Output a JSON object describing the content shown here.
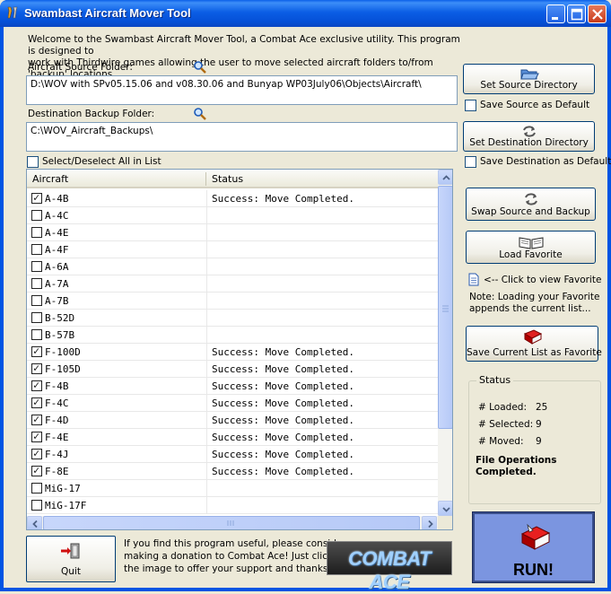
{
  "window": {
    "title": "Swambast Aircraft Mover Tool"
  },
  "welcome_line1": "Welcome to the Swambast Aircraft Mover Tool, a Combat Ace exclusive utility.  This program is designed to",
  "welcome_line2": "work with Thirdwire games allowing the user to move selected aircraft folders to/from 'backup' locations.",
  "source": {
    "label": "Aircraft Source Folder:",
    "value": "D:\\WOV with SPv05.15.06 and  v08.30.06 and Bunyap WP03July06\\Objects\\Aircraft\\"
  },
  "destination": {
    "label": "Destination Backup Folder:",
    "value": "C:\\WOV_Aircraft_Backups\\"
  },
  "select_all": {
    "label": "Select/Deselect  All in List",
    "checked": false
  },
  "list": {
    "columns": [
      "Aircraft",
      "Status"
    ],
    "rows": [
      {
        "name": "A-4B",
        "checked": true,
        "status": "Success:  Move Completed."
      },
      {
        "name": "A-4C",
        "checked": false,
        "status": ""
      },
      {
        "name": "A-4E",
        "checked": false,
        "status": ""
      },
      {
        "name": "A-4F",
        "checked": false,
        "status": ""
      },
      {
        "name": "A-6A",
        "checked": false,
        "status": ""
      },
      {
        "name": "A-7A",
        "checked": false,
        "status": ""
      },
      {
        "name": "A-7B",
        "checked": false,
        "status": ""
      },
      {
        "name": "B-52D",
        "checked": false,
        "status": ""
      },
      {
        "name": "B-57B",
        "checked": false,
        "status": ""
      },
      {
        "name": "F-100D",
        "checked": true,
        "status": "Success:  Move Completed."
      },
      {
        "name": "F-105D",
        "checked": true,
        "status": "Success:  Move Completed."
      },
      {
        "name": "F-4B",
        "checked": true,
        "status": "Success:  Move Completed."
      },
      {
        "name": "F-4C",
        "checked": true,
        "status": "Success:  Move Completed."
      },
      {
        "name": "F-4D",
        "checked": true,
        "status": "Success:  Move Completed."
      },
      {
        "name": "F-4E",
        "checked": true,
        "status": "Success:  Move Completed."
      },
      {
        "name": "F-4J",
        "checked": true,
        "status": "Success:  Move Completed."
      },
      {
        "name": "F-8E",
        "checked": true,
        "status": "Success:  Move Completed."
      },
      {
        "name": "MiG-17",
        "checked": false,
        "status": ""
      },
      {
        "name": "MiG-17F",
        "checked": false,
        "status": ""
      }
    ]
  },
  "buttons": {
    "set_source": "Set Source Directory",
    "save_source_default": "Save Source as Default",
    "set_destination": "Set Destination Directory",
    "save_destination_default": "Save Destination as Default",
    "swap": "Swap Source and Backup",
    "load_favorite": "Load Favorite",
    "view_favorite": "<-- Click to view Favorite",
    "note_line1": "Note: Loading your Favorite",
    "note_line2": "appends the current list...",
    "save_favorite": "Save Current List as Favorite",
    "quit": "Quit",
    "run": "RUN!"
  },
  "status": {
    "title": "Status",
    "loaded_label": "# Loaded:",
    "loaded": "25",
    "selected_label": "# Selected:",
    "selected": "9",
    "moved_label": "# Moved:",
    "moved": "9",
    "message_line1": "File Operations",
    "message_line2": "Completed."
  },
  "donation": {
    "line1": "If you find this program useful, please consider",
    "line2": "making a donation to Combat Ace!  Just click",
    "line3": "the image to offer your support and thanks!"
  },
  "banner_text": "COMBAT ACE"
}
